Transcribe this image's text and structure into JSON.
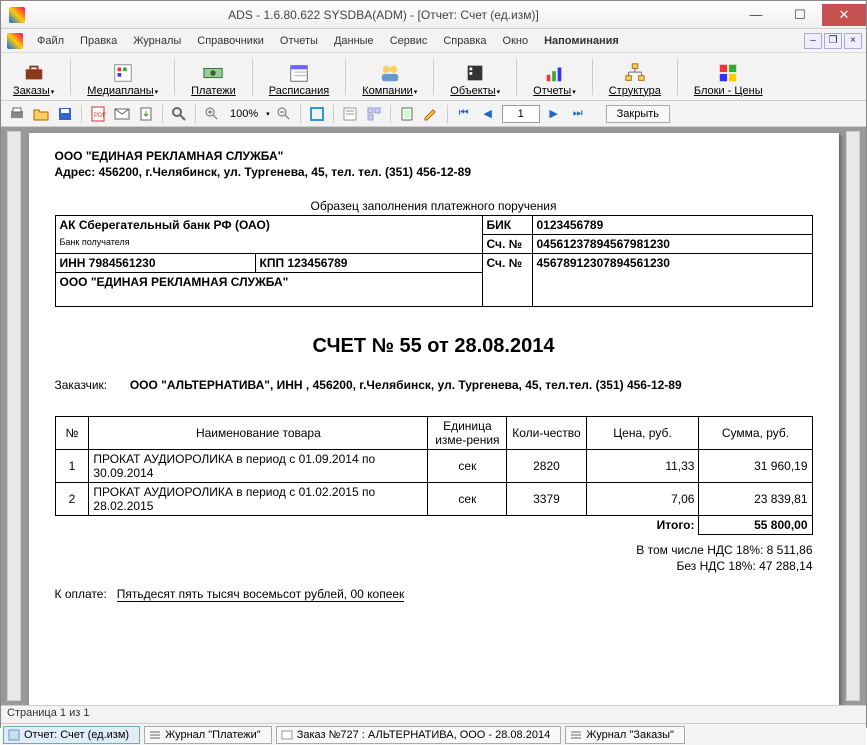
{
  "window": {
    "title": "ADS - 1.6.80.622 SYSDBA(ADM) - [Отчет: Счет (ед.изм)]"
  },
  "menu": {
    "items": [
      "Файл",
      "Правка",
      "Журналы",
      "Справочники",
      "Отчеты",
      "Данные",
      "Сервис",
      "Справка",
      "Окно"
    ],
    "reminders": "Напоминания"
  },
  "toolbar": {
    "orders": "Заказы",
    "mediaplans": "Медиапланы",
    "payments": "Платежи",
    "schedules": "Расписания",
    "companies": "Компании",
    "objects": "Объекты",
    "reports": "Отчеты",
    "structure": "Структура",
    "blocks": "Блоки - Цены"
  },
  "toolbar2": {
    "zoom": "100%",
    "page": "1",
    "close": "Закрыть"
  },
  "doc": {
    "company": "ООО \"ЕДИНАЯ РЕКЛАМНАЯ СЛУЖБА\"",
    "address": "Адрес: 456200, г.Челябинск, ул. Тургенева, 45, тел. тел. (351) 456-12-89",
    "sample_caption": "Образец заполнения платежного поручения",
    "bank_name": "АК Сберегательный банк РФ (ОАО)",
    "bank_receiver_lbl": "Банк получателя",
    "inn": "ИНН 7984561230",
    "kpp": "КПП 123456789",
    "payee": "ООО \"ЕДИНАЯ РЕКЛАМНАЯ СЛУЖБА\"",
    "bik_lbl": "БИК",
    "bik": "0123456789",
    "acct_lbl": "Сч. №",
    "corr_acct": "04561237894567981230",
    "acct": "45678912307894561230",
    "invoice_title": "СЧЕТ № 55 от 28.08.2014",
    "customer_lbl": "Заказчик:",
    "customer": "ООО \"АЛЬТЕРНАТИВА\", ИНН , 456200, г.Челябинск, ул. Тургенева, 45, тел.тел. (351) 456-12-89",
    "cols": {
      "num": "№",
      "name": "Наименование товара",
      "unit": "Единица изме-рения",
      "qty": "Коли-чество",
      "price": "Цена, руб.",
      "sum": "Сумма, руб."
    },
    "rows": [
      {
        "n": "1",
        "name": "ПРОКАТ АУДИОРОЛИКА в период с 01.09.2014 по 30.09.2014",
        "unit": "сек",
        "qty": "2820",
        "price": "11,33",
        "sum": "31 960,19"
      },
      {
        "n": "2",
        "name": "ПРОКАТ АУДИОРОЛИКА в период с 01.02.2015 по 28.02.2015",
        "unit": "сек",
        "qty": "3379",
        "price": "7,06",
        "sum": "23 839,81"
      }
    ],
    "total_lbl": "Итого:",
    "total": "55 800,00",
    "vat_incl": "В том числе НДС 18%: 8 511,86",
    "vat_excl": "Без НДС 18%: 47 288,14",
    "pay_lbl": "К оплате:",
    "pay_words": "Пятьдесят пять тысяч восемьсот рублей, 00 копеек"
  },
  "status": {
    "page": "Страница 1 из 1"
  },
  "tabs": {
    "t1": "Отчет: Счет (ед.изм)",
    "t2": "Журнал \"Платежи\"",
    "t3": "Заказ №727 : АЛЬТЕРНАТИВА, ООО - 28.08.2014",
    "t4": "Журнал \"Заказы\""
  }
}
